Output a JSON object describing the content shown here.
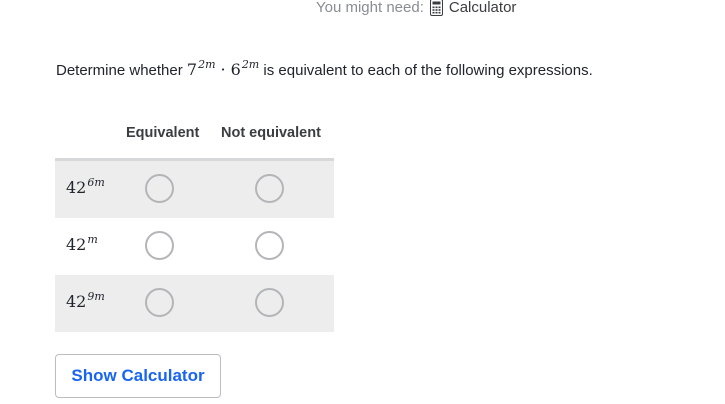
{
  "hint": {
    "prefix": "You might need:",
    "calculator_link": "Calculator",
    "icon": "calculator-icon"
  },
  "question": {
    "prefix": "Determine whether",
    "base1": "7",
    "exp1": "2m",
    "base2": "6",
    "exp2": "2m",
    "suffix": "is equivalent to each of the following expressions."
  },
  "table": {
    "columns": [
      "Equivalent",
      "Not equivalent"
    ],
    "rows": [
      {
        "base": "42",
        "exponent": "6m"
      },
      {
        "base": "42",
        "exponent": "m"
      },
      {
        "base": "42",
        "exponent": "9m"
      }
    ]
  },
  "show_calculator_button": "Show Calculator",
  "colors": {
    "accent": "#1865f2",
    "row_shade": "#ededed",
    "radio_border": "#b3b5b8"
  }
}
